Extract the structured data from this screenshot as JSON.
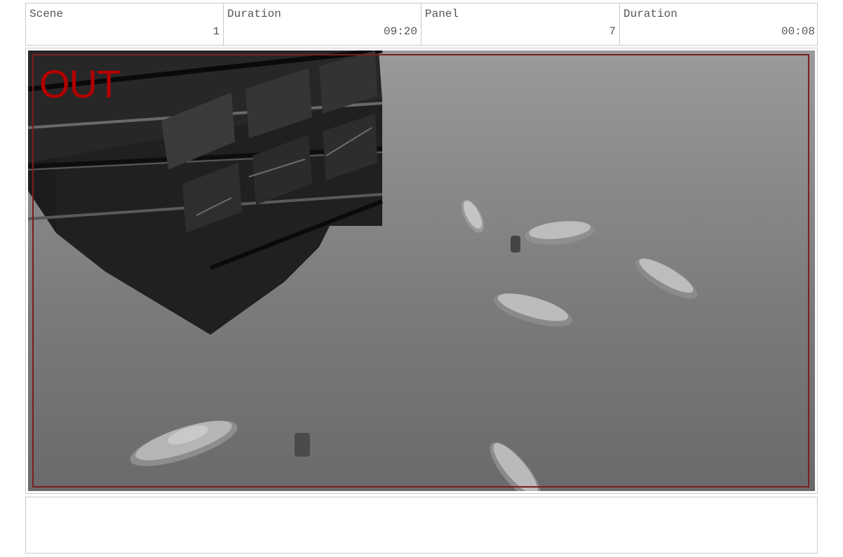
{
  "header": {
    "scene_label": "Scene",
    "scene_value": "1",
    "duration1_label": "Duration",
    "duration1_value": "09:20",
    "panel_label": "Panel",
    "panel_value": "7",
    "duration2_label": "Duration",
    "duration2_value": "00:08"
  },
  "viewport": {
    "overlay_label": "OUT",
    "frame_color": "#7a1f1f",
    "label_color": "#b30000"
  },
  "notes": {
    "text": ""
  }
}
